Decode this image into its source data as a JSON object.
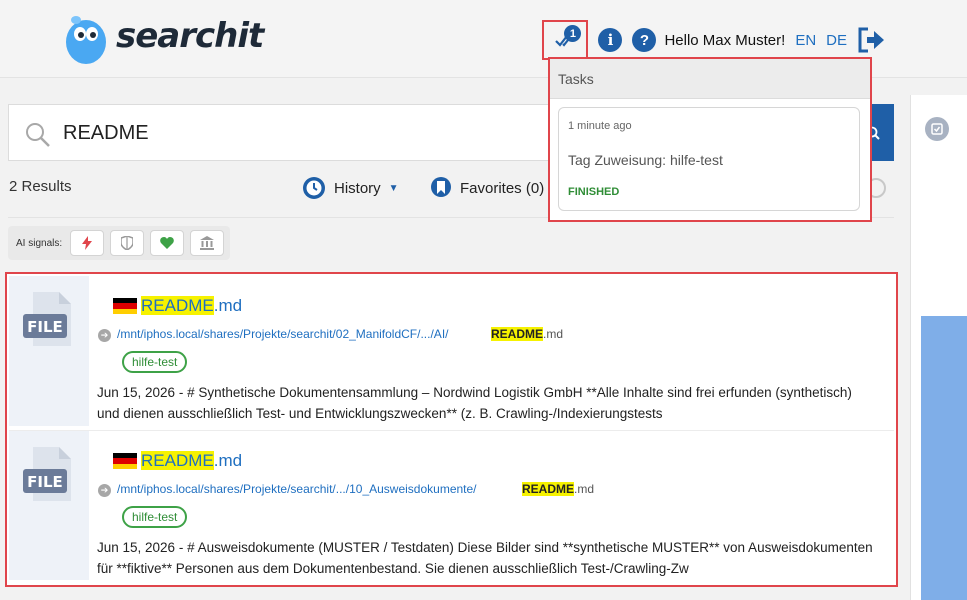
{
  "header": {
    "logo_text": "searchit",
    "tasks_badge": "1",
    "greeting": "Hello Max Muster!",
    "lang_en": "EN",
    "lang_de": "DE"
  },
  "search": {
    "query": "README"
  },
  "results_meta": {
    "count": "2 Results",
    "history_label": "History",
    "favorites_label": "Favorites (0)"
  },
  "ai_signals": {
    "label": "AI signals:",
    "chips": [
      "lightning-icon",
      "shield-icon",
      "heart-icon",
      "bank-icon"
    ]
  },
  "results": [
    {
      "title_highlight": "README",
      "title_rest": ".md",
      "path": "/mnt/iphos.local/shares/Projekte/searchit/02_ManifoldCF/.../AI/",
      "filename_highlight": "README",
      "filename_rest": ".md",
      "tag": "hilfe-test",
      "snippet": "Jun 15, 2026 - # Synthetische Dokumentensammlung – Nordwind Logistik GmbH **Alle Inhalte sind frei erfunden (synthetisch) und dienen ausschließlich Test- und Entwicklungszwecken** (z. B. Crawling-/Indexierungstests"
    },
    {
      "title_highlight": "README",
      "title_rest": ".md",
      "path": "/mnt/iphos.local/shares/Projekte/searchit/.../10_Ausweisdokumente/",
      "filename_highlight": "README",
      "filename_rest": ".md",
      "tag": "hilfe-test",
      "snippet": "Jun 15, 2026 - # Ausweisdokumente (MUSTER / Testdaten) Diese Bilder sind **synthetische MUSTER** von Ausweisdokumenten für **fiktive** Personen aus dem Dokumentenbestand. Sie dienen ausschließlich Test-/Crawling-Zw"
    }
  ],
  "file_icon_label": "FILE",
  "tasks_popup": {
    "header": "Tasks",
    "time": "1 minute ago",
    "title": "Tag Zuweisung: hilfe-test",
    "status": "FINISHED"
  },
  "colors": {
    "accent": "#1f5fa7",
    "link": "#1f6fc0",
    "highlight": "#f6f200",
    "tag_green": "#3ea247",
    "annotation_red": "#e0454b"
  }
}
